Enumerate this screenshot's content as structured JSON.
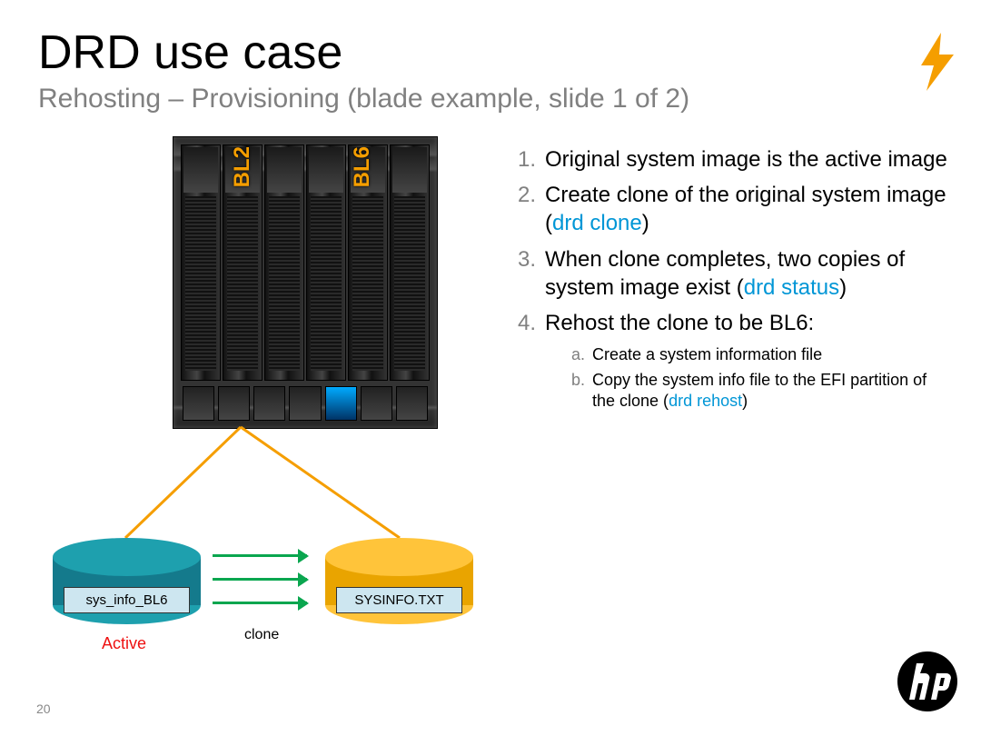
{
  "slide": {
    "title": "DRD use case",
    "subtitle": "Rehosting – Provisioning (blade example, slide 1 of 2)",
    "page_number": "20"
  },
  "blades": {
    "label_bl2": "BL2",
    "label_bl6": "BL6"
  },
  "diagram": {
    "disk_active_label": "sys_info_BL6",
    "disk_clone_label": "SYSINFO.TXT",
    "clone_arrow_label": "clone",
    "active_label": "Active"
  },
  "steps": [
    {
      "num": "1.",
      "text": "Original system image is the active image"
    },
    {
      "num": "2.",
      "text_a": "Create clone of the original system image (",
      "cmd": "drd clone",
      "text_b": ")"
    },
    {
      "num": "3.",
      "text_a": "When clone completes, two copies of system image exist (",
      "cmd": "drd status",
      "text_b": ")"
    },
    {
      "num": "4.",
      "text": "Rehost the clone to be BL6:"
    }
  ],
  "substeps": [
    {
      "num": "a.",
      "text": "Create a system information file"
    },
    {
      "num": "b.",
      "text_a": "Copy the system info file to the EFI partition of the clone (",
      "cmd": "drd rehost",
      "text_b": ")"
    }
  ]
}
